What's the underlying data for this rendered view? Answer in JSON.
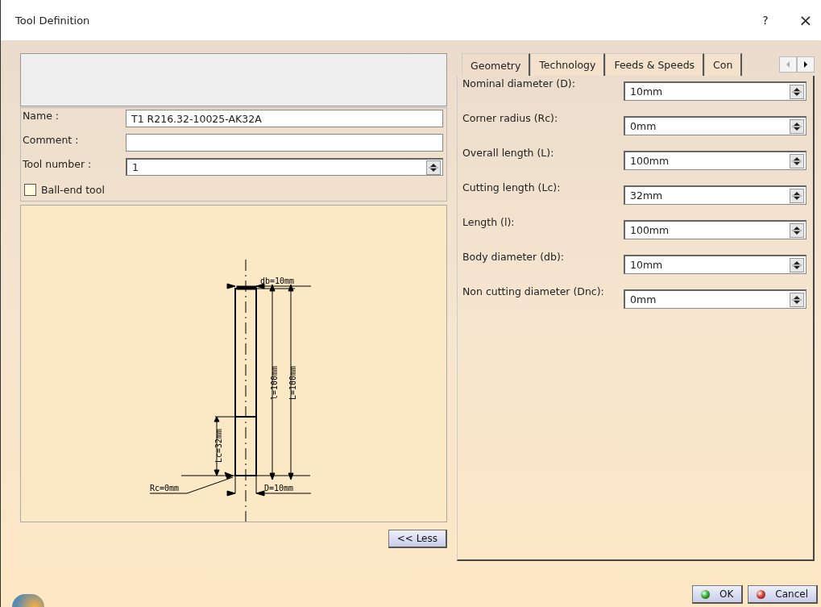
{
  "window": {
    "title": "Tool Definition",
    "help": "?",
    "close": "×"
  },
  "form": [
    {
      "kind": "text",
      "label": "Name :",
      "value": "T1 R216.32-10025-AK32A"
    },
    {
      "kind": "text",
      "label": "Comment :"
    },
    {
      "kind": "spin",
      "label": "Tool number :",
      "value": "1"
    }
  ],
  "ball_end": {
    "label": "Ball-end tool",
    "checked": false
  },
  "drawing": {
    "labels": [
      {
        "kind": "db",
        "text": "db=10mm"
      },
      {
        "kind": "l",
        "text": "l=100mm"
      },
      {
        "kind": "L",
        "text": "L=100mm"
      },
      {
        "kind": "Lc",
        "text": "Lc=32mm"
      },
      {
        "kind": "Rc",
        "text": "Rc=0mm"
      },
      {
        "kind": "D",
        "text": "D=10mm"
      }
    ]
  },
  "less_button": "<< Less",
  "tabs": [
    {
      "label": "Geometry",
      "selected": true
    },
    {
      "label": "Technology",
      "selected": false
    },
    {
      "label": "Feeds & Speeds",
      "selected": false
    },
    {
      "label": "Con",
      "selected": false
    }
  ],
  "tab_scroll": [
    {
      "kind": "left",
      "disabled": true
    },
    {
      "kind": "right",
      "disabled": false
    }
  ],
  "parameters": [
    {
      "label": "Nominal diameter (D):",
      "value": "10mm"
    },
    {
      "label": "Corner radius (Rc):",
      "value": "0mm"
    },
    {
      "label": "Overall length (L):",
      "value": "100mm"
    },
    {
      "label": "Cutting length (Lc):",
      "value": "32mm"
    },
    {
      "label": "Length (l):",
      "value": "100mm"
    },
    {
      "label": "Body diameter (db):",
      "value": "10mm"
    },
    {
      "label": "Non cutting diameter (Dnc):",
      "value": "0mm"
    }
  ],
  "buttons": [
    {
      "kind": "ok",
      "label": "OK"
    },
    {
      "kind": "cancel",
      "label": "Cancel"
    }
  ]
}
